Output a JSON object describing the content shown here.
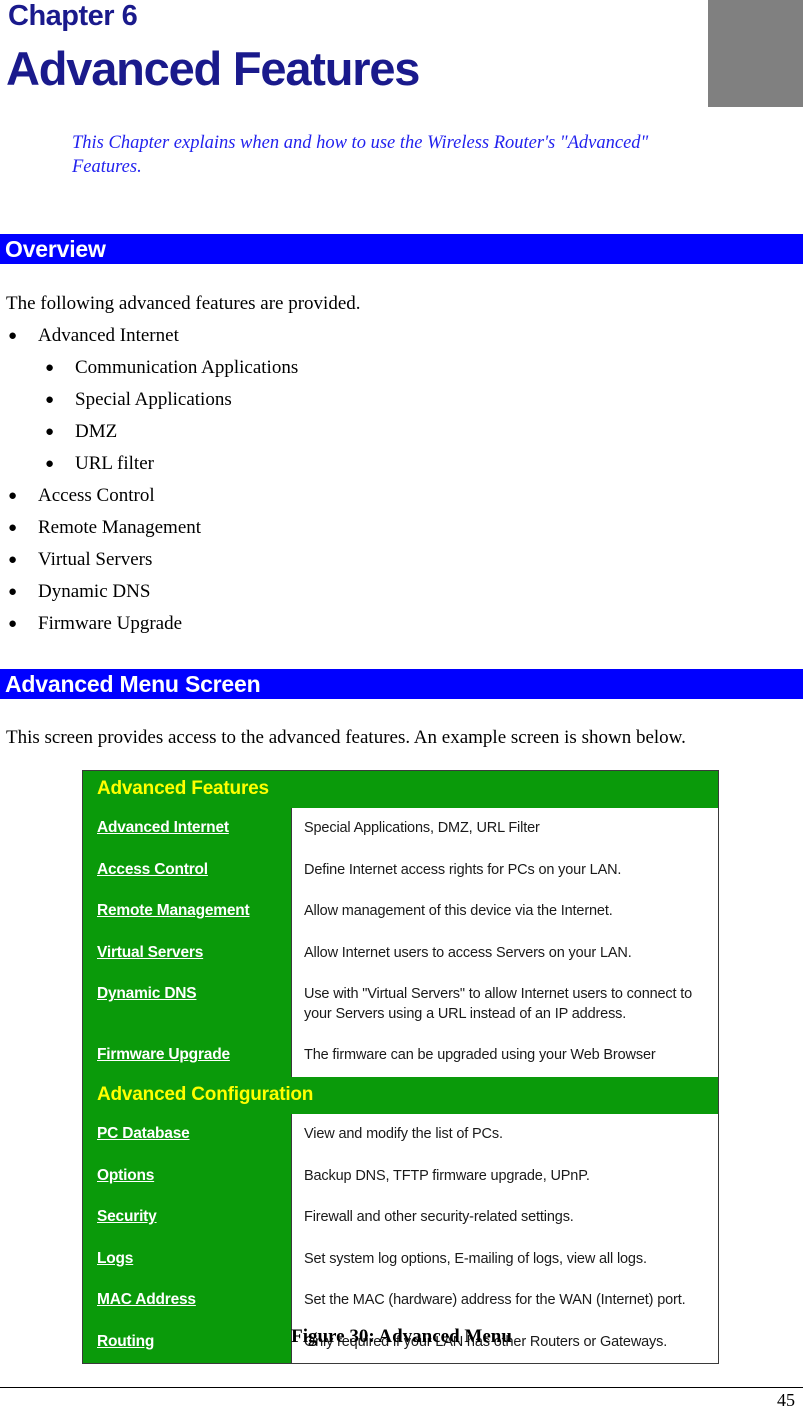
{
  "page": {
    "chapter_label": "Chapter 6",
    "chapter_title": "Advanced Features",
    "intro": "This Chapter explains when and how to use the Wireless Router's \"Advanced\" Features.",
    "page_number": "45",
    "figure_caption": "Figure 30: Advanced Menu",
    "accent_blue": "#0000ff",
    "title_navy": "#1a1a8c",
    "intro_blue": "#2222ee",
    "panel_green": "#0a9a0a",
    "panel_yellow": "#ffff00",
    "gray_block": "#808080"
  },
  "overview": {
    "heading": "Overview",
    "intro": "The following advanced features are provided.",
    "items": [
      {
        "level": 1,
        "label": "Advanced Internet"
      },
      {
        "level": 2,
        "label": "Communication Applications"
      },
      {
        "level": 2,
        "label": "Special Applications"
      },
      {
        "level": 2,
        "label": "DMZ"
      },
      {
        "level": 2,
        "label": "URL filter"
      },
      {
        "level": 1,
        "label": "Access Control"
      },
      {
        "level": 1,
        "label": "Remote Management"
      },
      {
        "level": 1,
        "label": "Virtual Servers"
      },
      {
        "level": 1,
        "label": "Dynamic DNS"
      },
      {
        "level": 1,
        "label": "Firmware Upgrade"
      }
    ]
  },
  "menu_screen": {
    "heading": "Advanced Menu Screen",
    "intro": "This screen provides access to the advanced features. An example screen is shown below."
  },
  "figure": {
    "sections": [
      {
        "title": "Advanced Features",
        "rows": [
          {
            "link": "Advanced Internet",
            "desc": "Special Applications, DMZ, URL Filter"
          },
          {
            "link": "Access Control",
            "desc": "Define Internet access rights for PCs on your LAN."
          },
          {
            "link": "Remote Management",
            "desc": "Allow management of this device via the Internet."
          },
          {
            "link": "Virtual Servers",
            "desc": "Allow Internet users to access Servers on your LAN."
          },
          {
            "link": "Dynamic DNS",
            "desc": "Use with \"Virtual Servers\" to allow Internet users to connect to your Servers using a URL instead of an IP address."
          },
          {
            "link": "Firmware Upgrade",
            "desc": "The firmware can be upgraded using your Web Browser"
          }
        ]
      },
      {
        "title": "Advanced Configuration",
        "rows": [
          {
            "link": "PC Database",
            "desc": "View and modify the list of PCs."
          },
          {
            "link": "Options",
            "desc": "Backup DNS, TFTP firmware upgrade, UPnP."
          },
          {
            "link": "Security",
            "desc": "Firewall and other security-related settings."
          },
          {
            "link": "Logs",
            "desc": "Set system log options, E-mailing of logs, view all logs."
          },
          {
            "link": "MAC Address",
            "desc": "Set the MAC (hardware) address for the WAN (Internet) port."
          },
          {
            "link": "Routing",
            "desc": "Only required if your LAN has other Routers or Gateways."
          }
        ]
      }
    ]
  }
}
